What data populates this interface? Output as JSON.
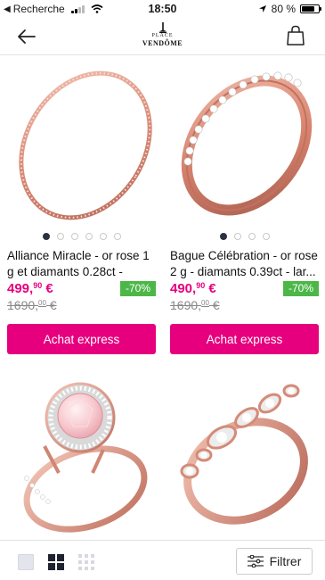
{
  "status_bar": {
    "back_app": "Recherche",
    "time": "18:50",
    "battery": "80 %",
    "battery_level": 0.8
  },
  "header": {
    "logo_line1": "PLACE",
    "logo_line2": "VENDÔME"
  },
  "products": [
    {
      "title": "Alliance Miracle - or rose 1 g et diamants 0.28ct - large...",
      "price_main": "499,",
      "price_cents": "90",
      "currency": " €",
      "discount": "-70%",
      "old_price_main": "1690,",
      "old_price_cents": "00",
      "old_currency": " €",
      "button": "Achat express",
      "image_dots": 6,
      "active_dot": 0
    },
    {
      "title": "Bague Célébration - or rose 2 g - diamants 0.39ct - lar...",
      "price_main": "490,",
      "price_cents": "90",
      "currency": " €",
      "discount": "-70%",
      "old_price_main": "1690,",
      "old_price_cents": "00",
      "old_currency": " €",
      "button": "Achat express",
      "image_dots": 4,
      "active_dot": 0
    },
    {
      "title": "",
      "image": "rose-gold halo ring with pink stone"
    },
    {
      "title": "",
      "image": "rose-gold marquise diamond ring"
    }
  ],
  "bottom_bar": {
    "filter_label": "Filtrer",
    "views": [
      "list-view",
      "grid-view",
      "dense-grid-view"
    ],
    "active_view": "grid-view"
  },
  "colors": {
    "accent": "#e6007e",
    "discount": "#4cb748",
    "rose_gold": "#e8a28e"
  }
}
